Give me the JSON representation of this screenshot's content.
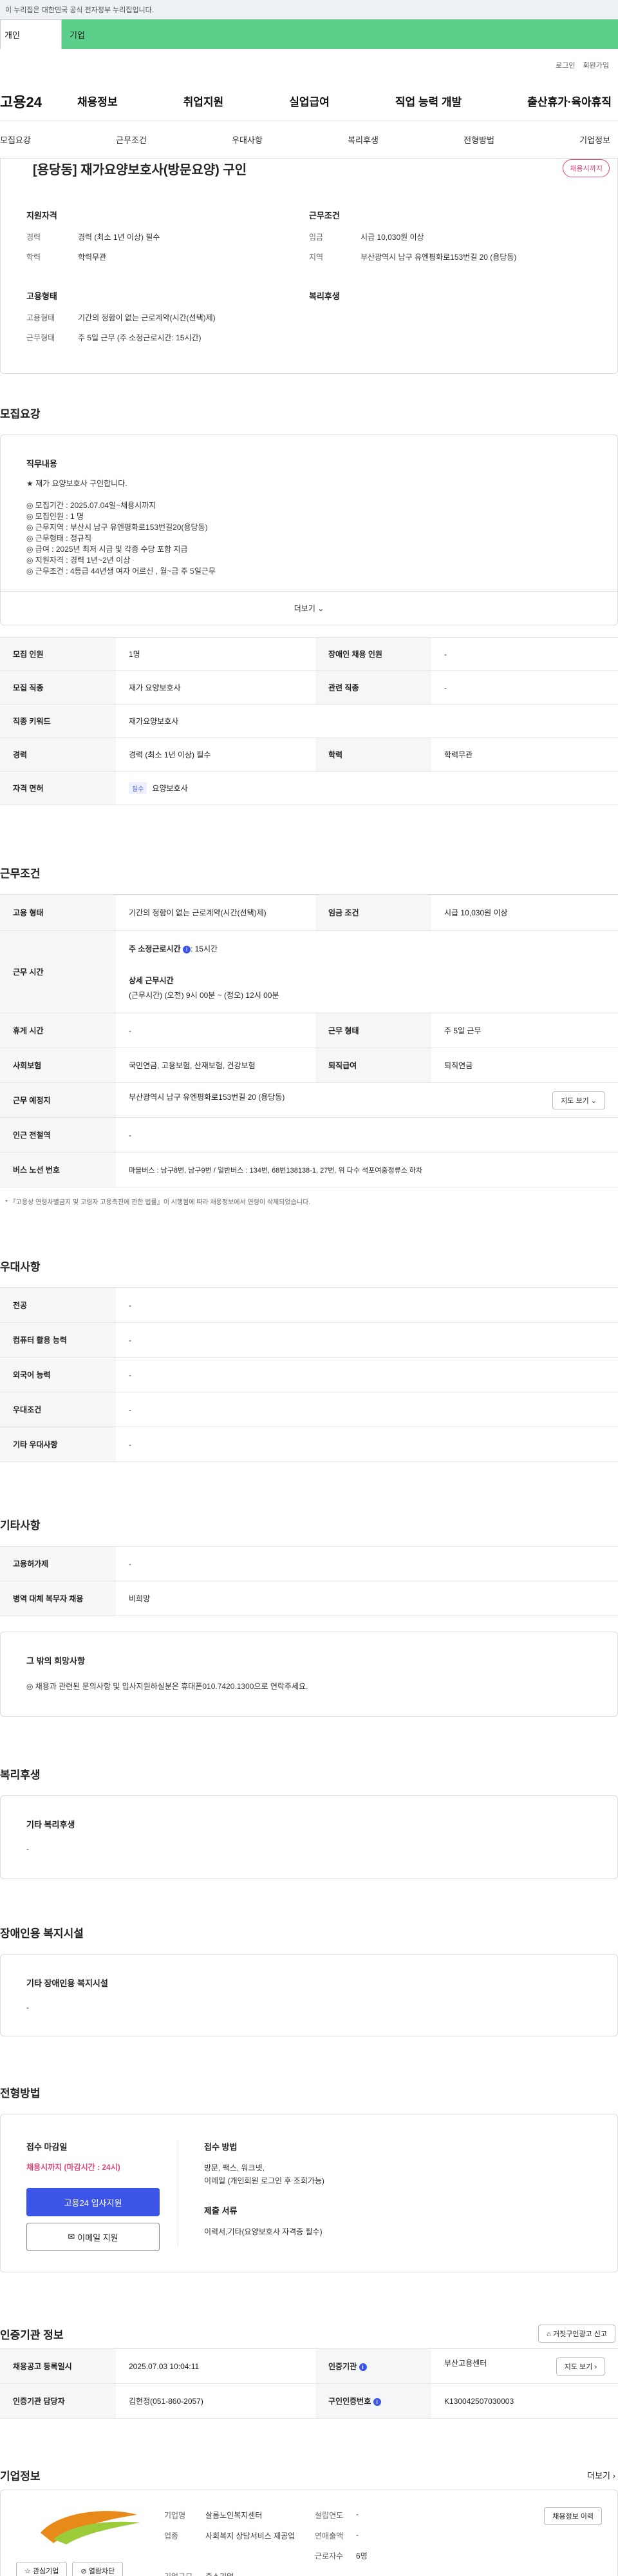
{
  "gov_banner": "이 누리집은 대한민국 공식 전자정부 누리집입니다.",
  "user_tabs": [
    "개인",
    "기업"
  ],
  "util_links": [
    "로그인",
    "회원가입"
  ],
  "logo": "고용24",
  "gnb": [
    "채용정보",
    "취업지원",
    "실업급여",
    "직업 능력 개발",
    "출산휴가·육아휴직"
  ],
  "anchor_tabs": [
    "모집요강",
    "근무조건",
    "우대사항",
    "복리후생",
    "전형방법",
    "기업정보"
  ],
  "summary": {
    "title": "[용당동] 재가요양보호사(방문요양) 구인",
    "badge": "채용시까지",
    "qual_title": "지원자격",
    "cond_title": "근무조건",
    "emp_title": "고용형태",
    "welfare_title": "복리후생",
    "qual": [
      {
        "k": "경력",
        "v": "경력 (최소 1년 이상) 필수"
      },
      {
        "k": "학력",
        "v": "학력무관"
      }
    ],
    "cond": [
      {
        "k": "임금",
        "v": "시급 10,030원 이상"
      },
      {
        "k": "지역",
        "v": "부산광역시 남구 유엔평화로153번길 20 (용당동)"
      }
    ],
    "emp": [
      {
        "k": "고용형태",
        "v": "기간의 정함이 없는 근로계약(시간(선택)제)"
      },
      {
        "k": "근무형태",
        "v": "주 5일 근무 (주 소정근로시간: 15시간)"
      }
    ]
  },
  "recruit": {
    "section_title": "모집요강",
    "job_desc_title": "직무내용",
    "lines": [
      "★ 재가 요양보호사 구인합니다.",
      "",
      "◎ 모집기간 : 2025.07.04일~채용시까지",
      "◎ 모집인원 : 1 명",
      "◎ 근무지역 : 부산시 남구 유엔평화로153번길20(용당동)",
      "◎ 근무형태 : 정규직",
      "◎ 급여 : 2025년 최저 시급 및 각종 수당 포함 지급",
      "◎ 지원자격 : 경력 1년~2년 이상",
      "◎ 근무조건 : 4등급 44년생 여자 어르신 , 월~금 주 5일근무"
    ],
    "more": "더보기",
    "rows": [
      [
        {
          "k": "모집 인원",
          "v": "1명"
        },
        {
          "k": "장애인 채용 인원",
          "v": "-"
        }
      ],
      [
        {
          "k": "모집 직종",
          "v": "재가 요양보호사"
        },
        {
          "k": "관련 직종",
          "v": "-"
        }
      ],
      [
        {
          "k": "직종 키워드",
          "v": "재가요양보호사"
        }
      ],
      [
        {
          "k": "경력",
          "v": "경력 (최소 1년 이상) 필수"
        },
        {
          "k": "학력",
          "v": "학력무관"
        }
      ]
    ],
    "license_k": "자격 면허",
    "license_chip": "필수",
    "license_v": "요양보호사"
  },
  "work": {
    "section_title": "근무조건",
    "emp_type_k": "고용 형태",
    "emp_type_v": "기간의 정함이 없는 근로계약(시간(선택)제)",
    "wage_k": "임금 조건",
    "wage_v": "시급 10,030원 이상",
    "time_k": "근무 시간",
    "weekly_label": "주 소정근로시간",
    "weekly_v": ": 15시간",
    "detail_label": "상세 근무시간",
    "detail_v": "(근무시간) (오전) 9시 00분 ~ (정오) 12시 00분",
    "rest_k": "휴게 시간",
    "rest_v": "-",
    "form_k": "근무 형태",
    "form_v": "주 5일 근무",
    "ins_k": "사회보험",
    "ins_v": "국민연금, 고용보험, 산재보험, 건강보험",
    "ret_k": "퇴직급여",
    "ret_v": "퇴직연금",
    "place_k": "근무 예정지",
    "place_v": "부산광역시 남구 유엔평화로153번길 20 (용당동)",
    "map_btn": "지도 보기",
    "station_k": "인근 전철역",
    "station_v": "-",
    "bus_k": "버스 노선 번호",
    "bus_v": "마을버스 : 남구8번, 남구9번 / 일반버스 : 134번, 68번138138-1, 27번, 위 다수 석포여중정류소 하차",
    "note": "* 『고용상 연령차별금지 및 고령자 고용촉진에 관한 법률』이 시행됨에 따라 채용정보에서 연령이 삭제되었습니다."
  },
  "pref": {
    "section_title": "우대사항",
    "rows": [
      {
        "k": "전공",
        "v": "-"
      },
      {
        "k": "컴퓨터 활용 능력",
        "v": "-"
      },
      {
        "k": "외국어 능력",
        "v": "-"
      },
      {
        "k": "우대조건",
        "v": "-"
      },
      {
        "k": "기타 우대사항",
        "v": "-"
      }
    ]
  },
  "etc": {
    "section_title": "기타사항",
    "rows": [
      {
        "k": "고용허가제",
        "v": "-"
      },
      {
        "k": "병역 대체 복무자 채용",
        "v": "비희망"
      }
    ],
    "other_title": "그 밖의 희망사항",
    "other_v": "◎ 채용과 관련된 문의사항 및 입사지원하실분은 휴대폰010.7420.1300으로 연락주세요."
  },
  "welfare": {
    "section_title": "복리후생",
    "box_title": "기타 복리후생",
    "box_v": "-"
  },
  "disabled": {
    "section_title": "장애인용 복지시설",
    "box_title": "기타 장애인용 복지시설",
    "box_v": "-"
  },
  "apply": {
    "section_title": "전형방법",
    "deadline_title": "접수 마감일",
    "deadline_v": "채용시까지 (마감시간 : 24시)",
    "apply_btn": "고용24 입사지원",
    "email_btn": "이메일 지원",
    "method_title": "접수 방법",
    "method_v1": "방문, 팩스, 워크넷,",
    "method_v2": "이메일 (개인회원 로그인 후 조회가능)",
    "docs_title": "제출 서류",
    "docs_v": "이력서,기타(요양보호사 자격증 필수)"
  },
  "cert": {
    "section_title": "인증기관 정보",
    "report_btn": "거짓구인광고 신고",
    "reg_k": "채용공고 등록일시",
    "reg_v": "2025.07.03 10:04:11",
    "org_k": "인증기관",
    "org_v": "부산고용센터",
    "map_btn": "지도 보기",
    "staff_k": "인증기관 담당자",
    "staff_v": "김현정(051-860-2057)",
    "no_k": "구인인증번호",
    "no_v": "K130042507030003"
  },
  "company": {
    "section_title": "기업정보",
    "more": "더보기",
    "interest_btn": "관심기업",
    "block_btn": "열람차단",
    "name_k": "기업명",
    "name_v": "살롬노인복지센터",
    "founded_k": "설립연도",
    "founded_v": "-",
    "biz_k": "업종",
    "biz_v": "사회복지 상담서비스 제공업",
    "sales_k": "연매출액",
    "sales_v": "-",
    "emp_k": "근로자수",
    "emp_v": "6명",
    "size_k": "기업규모",
    "size_v": "중소기업",
    "info_btn": "채용정보 이력"
  }
}
